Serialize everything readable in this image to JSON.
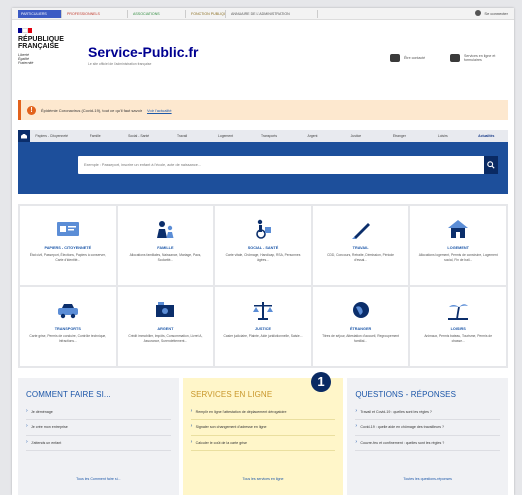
{
  "audience_tabs": [
    "Particuliers",
    "Professionnels",
    "Associations",
    "Fonction publique",
    "Annuaire de l'administration"
  ],
  "account_label": "Se connecter",
  "header": {
    "republic": [
      "RÉPUBLIQUE",
      "FRANÇAISE"
    ],
    "motto": [
      "Liberté",
      "Égalité",
      "Fraternité"
    ],
    "site_name": "Service-Public.fr",
    "site_tagline": "Le site officiel de l'administration française",
    "link_contact": "Être contacté",
    "link_services": "Services en ligne et formulaires"
  },
  "alert": {
    "text": "Épidémie Coronavirus (Covid-19), tout ce qu'il faut savoir",
    "link": "Voir l'actualité"
  },
  "nav": [
    "Papiers - Citoyenneté",
    "Famille",
    "Social - Santé",
    "Travail",
    "Logement",
    "Transports",
    "Argent",
    "Justice",
    "Étranger",
    "Loisirs",
    "Actualités"
  ],
  "search": {
    "placeholder": "Exemple : Passeport, inscrire un enfant à l'école, acte de naissance..."
  },
  "themes": [
    {
      "title": "Papiers - Citoyenneté",
      "desc": "État civil, Passeport, Élections, Papiers à conserver, Carte d'identité..."
    },
    {
      "title": "Famille",
      "desc": "Allocations familiales, Naissance, Mariage, Pacs, Scolarité..."
    },
    {
      "title": "Social - Santé",
      "desc": "Carte vitale, Chômage, Handicap, RSA, Personnes âgées..."
    },
    {
      "title": "Travail",
      "desc": "CDD, Concours, Retraite, Démission, Période d'essai..."
    },
    {
      "title": "Logement",
      "desc": "Allocations logement, Permis de construire, Logement social, Fin de bail..."
    },
    {
      "title": "Transports",
      "desc": "Carte grise, Permis de conduire, Contrôle technique, Infractions..."
    },
    {
      "title": "Argent",
      "desc": "Crédit immobilier, Impôts, Consommation, Livret A, Assurance, Surendettement..."
    },
    {
      "title": "Justice",
      "desc": "Casier judiciaire, Plainte, Aide juridictionnelle, Saisie..."
    },
    {
      "title": "Étranger",
      "desc": "Titres de séjour, Attestation d'accueil, Regroupement familial..."
    },
    {
      "title": "Loisirs",
      "desc": "Animaux, Permis bateau, Tourisme, Permis de chasse..."
    }
  ],
  "bottom": {
    "left": {
      "title": "Comment faire si...",
      "items": [
        "Je déménage",
        "Je crée mon entreprise",
        "J'attends un enfant"
      ],
      "all": "Tous les Comment faire si..."
    },
    "middle": {
      "title": "Services en ligne",
      "items": [
        "Remplir en ligne l'attestation de déplacement dérogatoire",
        "Signaler son changement d'adresse en ligne",
        "Calculer le coût de la carte grise"
      ],
      "all": "Tous les services en ligne"
    },
    "right": {
      "title": "Questions - Réponses",
      "items": [
        "Travail et Covid-19 : quelles sont les règles ?",
        "Covid-19 : quelle aide en chômage des travailleurs ?",
        "Couvre-feu et confinement : quelles sont les règles ?"
      ],
      "all": "Toutes les questions-réponses"
    }
  },
  "badge_number": "1",
  "colors": {
    "brand_blue": "#000091",
    "band_blue": "#1d4f9b",
    "alert_orange": "#e2621c",
    "yellow_panel": "#fff6c9"
  }
}
